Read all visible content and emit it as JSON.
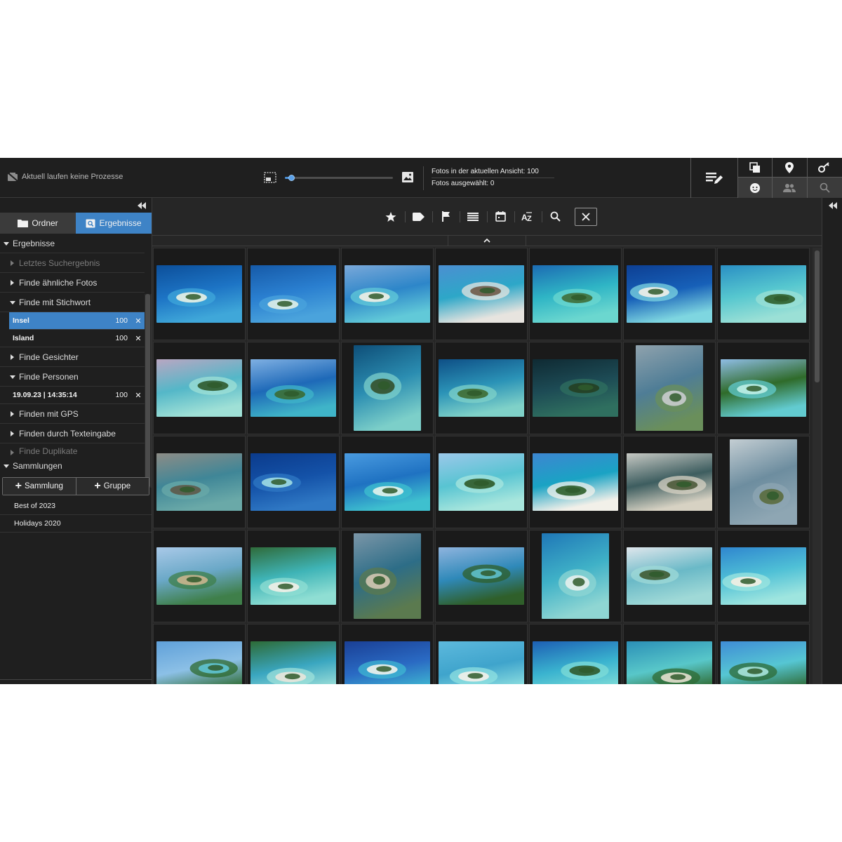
{
  "topbar": {
    "process_status": "Aktuell laufen keine Prozesse",
    "thumb_size_fraction": 0.06,
    "photos_in_view": "Fotos in der aktuellen Ansicht: 100",
    "photos_selected": "Fotos ausgewählt: 0",
    "tool_icons": [
      "edit-list-icon",
      "copy-stack-icon",
      "map-pin-icon",
      "key-icon",
      "face-icon",
      "people-icon",
      "search-icon"
    ]
  },
  "sidebar": {
    "tabs": [
      {
        "label": "Ordner",
        "icon": "folder-icon",
        "active": false
      },
      {
        "label": "Ergebnisse",
        "icon": "search-results-icon",
        "active": true
      }
    ],
    "results_header": "Ergebnisse",
    "last_search": "Letztes Suchergebnis",
    "similar": "Finde ähnliche Fotos",
    "keyword": "Finde mit Stichwort",
    "keyword_results": [
      {
        "name": "Insel",
        "score": "100",
        "selected": true
      },
      {
        "name": "Island",
        "score": "100",
        "selected": false
      }
    ],
    "faces": "Finde Gesichter",
    "persons": "Finde Personen",
    "person_results": [
      {
        "name": "19.09.23 | 14:35:14",
        "score": "100"
      }
    ],
    "gps": "Finden mit GPS",
    "text": "Finden durch Texteingabe",
    "duplicates": "Finde Duplikate",
    "collections_header": "Sammlungen",
    "add_collection": "Sammlung",
    "add_group": "Gruppe",
    "collections": [
      "Best of 2023",
      "Holidays 2020"
    ],
    "remove_symbol": "✕"
  },
  "filterbar": {
    "icons": [
      "star-icon",
      "label-icon",
      "flag-icon",
      "list-icon",
      "calendar-icon",
      "sort-az-icon",
      "search-icon",
      "close-icon"
    ]
  },
  "colors": {
    "accent": "#3e83c6",
    "background": "#262626",
    "panel": "#1f1f1f"
  },
  "photos": [
    {
      "kind": "landscape",
      "palette": [
        "#0c4f9a",
        "#1d74c5",
        "#3fa7d9",
        "#e9f2e6"
      ]
    },
    {
      "kind": "landscape",
      "palette": [
        "#165aa8",
        "#2a7fd0",
        "#4aa3dc",
        "#dfeee7"
      ]
    },
    {
      "kind": "landscape",
      "palette": [
        "#7aa8d9",
        "#2d86c9",
        "#61c9d8",
        "#f1efe6"
      ]
    },
    {
      "kind": "landscape",
      "palette": [
        "#4b8fd1",
        "#2da7c8",
        "#e7e4df",
        "#6f5a48"
      ]
    },
    {
      "kind": "landscape",
      "palette": [
        "#1c6bb3",
        "#2fb5c5",
        "#6bd7cf",
        "#3f6e3a"
      ]
    },
    {
      "kind": "landscape",
      "palette": [
        "#0d3f93",
        "#1760b8",
        "#7ed6e0",
        "#f0f0e8"
      ]
    },
    {
      "kind": "landscape",
      "palette": [
        "#2a8fc4",
        "#56c7cf",
        "#9be0d6",
        "#2f5f2c"
      ]
    },
    {
      "kind": "landscape",
      "palette": [
        "#b9a6c2",
        "#54b7c8",
        "#9fe0d6",
        "#2f5a2d"
      ]
    },
    {
      "kind": "landscape",
      "palette": [
        "#7fb0e3",
        "#1e69b8",
        "#3fb4c8",
        "#3b6b34"
      ]
    },
    {
      "kind": "portrait",
      "palette": [
        "#0e4e78",
        "#2b8db1",
        "#7ccfc9",
        "#33502c"
      ]
    },
    {
      "kind": "landscape",
      "palette": [
        "#0e4f86",
        "#2b93b7",
        "#7fd1c8",
        "#3e6b32"
      ]
    },
    {
      "kind": "landscape",
      "palette": [
        "#0f2a33",
        "#1d4b55",
        "#2f6f5f",
        "#233f22"
      ]
    },
    {
      "kind": "portrait",
      "palette": [
        "#8fa2ad",
        "#4f7d96",
        "#6a8f5b",
        "#c9ccce"
      ]
    },
    {
      "kind": "landscape",
      "palette": [
        "#8fbde5",
        "#2f6b2a",
        "#62cbd0",
        "#bfeee6"
      ]
    },
    {
      "kind": "landscape",
      "palette": [
        "#8d8c86",
        "#3f8697",
        "#6aa9a8",
        "#5d5949"
      ]
    },
    {
      "kind": "landscape",
      "palette": [
        "#0b3b8c",
        "#1452a8",
        "#2f78c4",
        "#9fdbe2"
      ]
    },
    {
      "kind": "landscape",
      "palette": [
        "#4a9be0",
        "#1f72c2",
        "#3ec0cf",
        "#e3f3ec"
      ]
    },
    {
      "kind": "landscape",
      "palette": [
        "#9cc8ea",
        "#58c4d2",
        "#a8e6dd",
        "#2e5a28"
      ]
    },
    {
      "kind": "landscape",
      "palette": [
        "#3d86d1",
        "#1aa3c4",
        "#f2f0e9",
        "#2d5e2a"
      ]
    },
    {
      "kind": "landscape",
      "palette": [
        "#c7c9c4",
        "#3d5d5f",
        "#d7d2c3",
        "#4c5a3a"
      ]
    },
    {
      "kind": "portrait",
      "palette": [
        "#c4ced3",
        "#6d8d9f",
        "#8ea6b3",
        "#5a6b3e"
      ]
    },
    {
      "kind": "landscape",
      "palette": [
        "#a9c9e8",
        "#6aa8c7",
        "#3f7f4a",
        "#c9b58e"
      ]
    },
    {
      "kind": "landscape",
      "palette": [
        "#2f6b3a",
        "#3fb4b7",
        "#8fded3",
        "#f1efe7"
      ]
    },
    {
      "kind": "portrait",
      "palette": [
        "#7b96a8",
        "#2d6d87",
        "#5b7a4f",
        "#d2c7b2"
      ]
    },
    {
      "kind": "landscape",
      "palette": [
        "#8fb4de",
        "#2f89b9",
        "#2f5f2a",
        "#5fc0cb"
      ]
    },
    {
      "kind": "portrait",
      "palette": [
        "#1f77b7",
        "#3fb1c7",
        "#8fd6d3",
        "#e6f0ec"
      ]
    },
    {
      "kind": "landscape",
      "palette": [
        "#dfe6ec",
        "#6ab9c7",
        "#9fd9d7",
        "#3f5a33"
      ]
    },
    {
      "kind": "landscape",
      "palette": [
        "#2f86cf",
        "#4fc0d6",
        "#9ee5df",
        "#f3efe3"
      ]
    },
    {
      "kind": "landscape",
      "palette": [
        "#5fa0d9",
        "#8cc0e6",
        "#2d6a2e",
        "#5fc4d3"
      ]
    },
    {
      "kind": "landscape",
      "palette": [
        "#2d6b36",
        "#3aa6c0",
        "#9ee0d9",
        "#e8e6db"
      ]
    },
    {
      "kind": "landscape",
      "palette": [
        "#1a3f95",
        "#2a6ac3",
        "#3fb7d1",
        "#eef2ec"
      ]
    },
    {
      "kind": "landscape",
      "palette": [
        "#5db9dd",
        "#3fa4cc",
        "#8fe0e0",
        "#f3f1ea"
      ]
    },
    {
      "kind": "landscape",
      "palette": [
        "#1d5fb4",
        "#3ab3cf",
        "#7fdcd7",
        "#2f5a2c"
      ]
    },
    {
      "kind": "landscape",
      "palette": [
        "#2b8fb7",
        "#58c7c9",
        "#2f6a31",
        "#e4e0cf"
      ]
    },
    {
      "kind": "landscape",
      "palette": [
        "#3f8cd6",
        "#56c6d3",
        "#2e6a34",
        "#a9e4dd"
      ]
    }
  ]
}
